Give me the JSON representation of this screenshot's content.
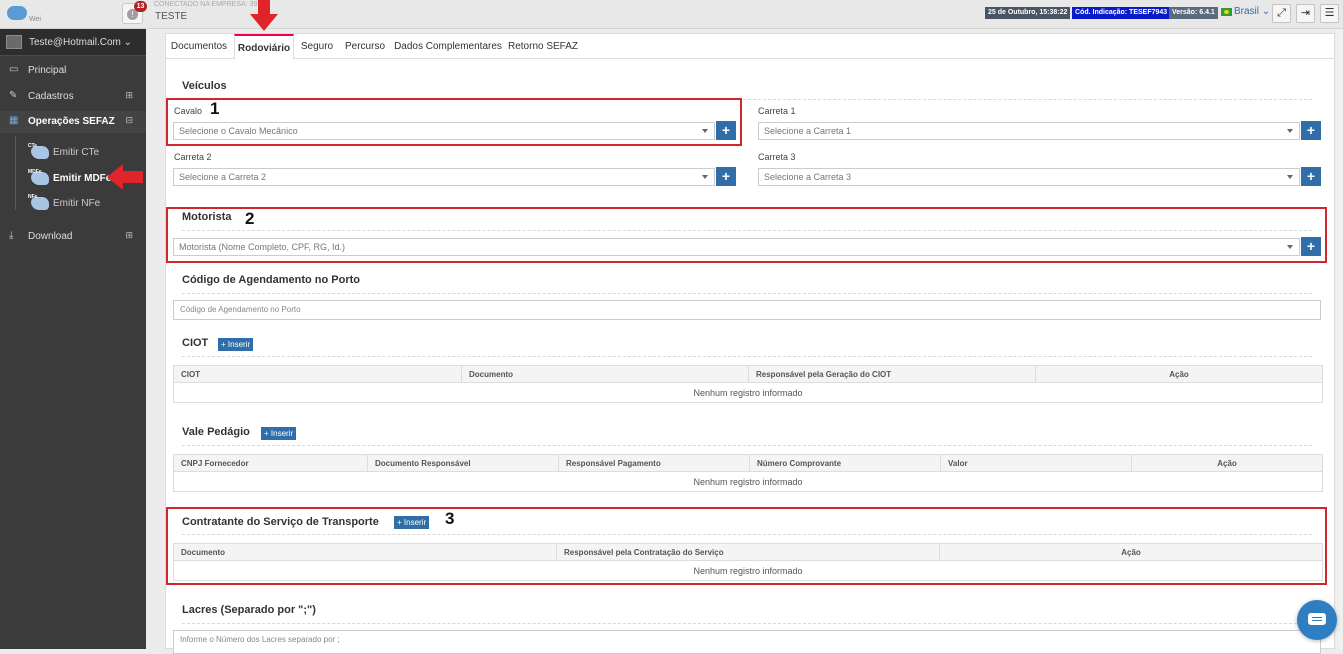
{
  "topbar": {
    "logo_sub": "Wei",
    "notif_count": "13",
    "company_label": "CONECTADO NA EMPRESA: 39",
    "company_name": "TESTE",
    "date": "25 de Outubro, 15:38:22",
    "code": "Cód. Indicação: TESEF7943",
    "version": "Versão: 6.4.1",
    "language": "Brasil",
    "colors": {
      "date": "#4a5563",
      "code": "#0a1bcc",
      "version": "#5a6c7c"
    }
  },
  "sidebar": {
    "user_email": "Teste@Hotmail.Com",
    "items": [
      {
        "label": "Principal",
        "icon": "monitor-icon"
      },
      {
        "label": "Cadastros",
        "icon": "edit-icon",
        "toggle": "⊞"
      },
      {
        "label": "Operações SEFAZ",
        "icon": "windows-icon",
        "toggle": "⊟"
      },
      {
        "label": "Download",
        "icon": "download-icon",
        "toggle": "⊞"
      }
    ],
    "subitems": [
      {
        "label": "Emitir CTe",
        "tag": "CTe"
      },
      {
        "label": "Emitir MDFe",
        "tag": "MDFe"
      },
      {
        "label": "Emitir NFe",
        "tag": "NFe"
      }
    ]
  },
  "tabs": [
    "Documentos",
    "Rodoviário",
    "Seguro",
    "Percurso",
    "Dados Complementares",
    "Retorno SEFAZ"
  ],
  "veiculos": {
    "title": "Veículos",
    "cavalo_label": "Cavalo",
    "cavalo_placeholder": "Selecione o Cavalo Mecânico",
    "carreta1_label": "Carreta 1",
    "carreta1_placeholder": "Selecione a Carreta 1",
    "carreta2_label": "Carreta 2",
    "carreta2_placeholder": "Selecione a Carreta 2",
    "carreta3_label": "Carreta 3",
    "carreta3_placeholder": "Selecione a Carreta 3"
  },
  "motorista": {
    "title": "Motorista",
    "placeholder": "Motorista (Nome Completo, CPF, RG, Id.)"
  },
  "agendamento": {
    "title": "Código de Agendamento no Porto",
    "placeholder": "Código de Agendamento no Porto"
  },
  "ciot": {
    "title": "CIOT",
    "insert": "+ Inserir",
    "columns": [
      "CIOT",
      "Documento",
      "Responsável pela Geração do CIOT",
      "Ação"
    ],
    "empty": "Nenhum registro informado"
  },
  "pedagio": {
    "title": "Vale Pedágio",
    "insert": "+ Inserir",
    "columns": [
      "CNPJ Fornecedor",
      "Documento Responsável",
      "Responsável Pagamento",
      "Número Comprovante",
      "Valor",
      "Ação"
    ],
    "empty": "Nenhum registro informado"
  },
  "contratante": {
    "title": "Contratante do Serviço de Transporte",
    "insert": "+ Inserir",
    "columns": [
      "Documento",
      "Responsável pela Contratação do Serviço",
      "Ação"
    ],
    "empty": "Nenhum registro informado"
  },
  "lacres": {
    "title": "Lacres (Separado por \";\")",
    "placeholder": "Informe o Número dos Lacres separado por ;"
  },
  "annotations": [
    "1",
    "2",
    "3"
  ]
}
